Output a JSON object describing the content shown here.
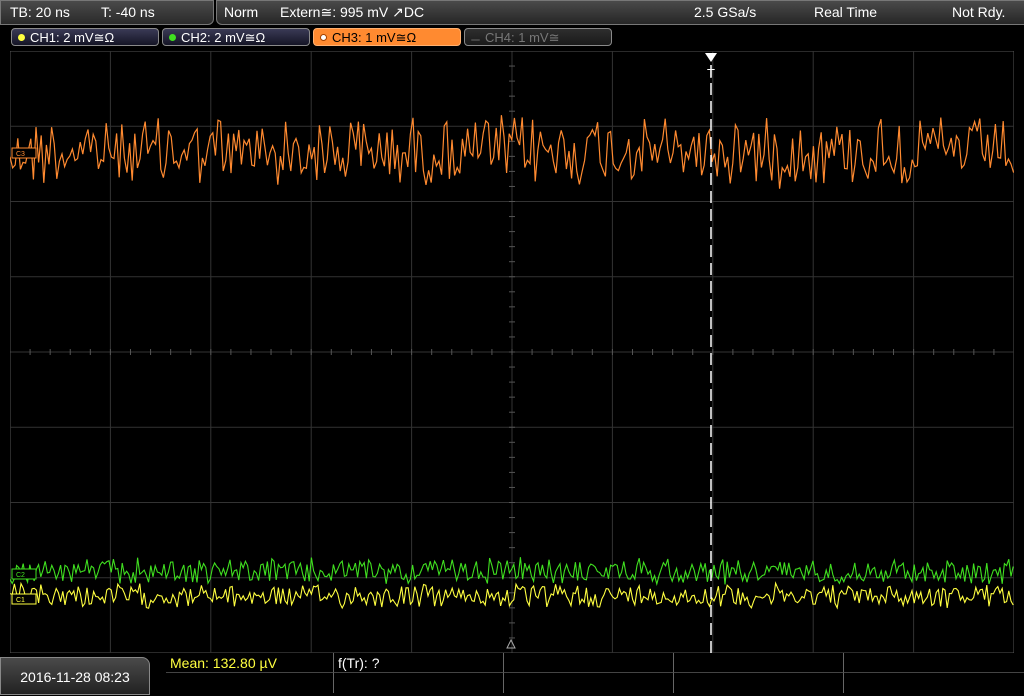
{
  "status": {
    "timebase": "TB: 20 ns",
    "trigger_time": "T: -40 ns",
    "mode": "Norm",
    "trigger_source": "Extern≅: 995 mV ↗DC",
    "sample_rate": "2.5 GSa/s",
    "acq_mode": "Real Time",
    "state": "Not Rdy."
  },
  "channels": [
    {
      "label": "CH1: 2 mV≅Ω",
      "color": "#ffff40",
      "state": "on"
    },
    {
      "label": "CH2: 2 mV≅Ω",
      "color": "#40e020",
      "state": "on"
    },
    {
      "label": "CH3: 1 mV≅Ω",
      "color": "#ff8a30",
      "state": "active"
    },
    {
      "label": "CH4: 1 mV≅",
      "color": "#777777",
      "state": "off"
    }
  ],
  "markers": {
    "ch3": "C3",
    "ch2": "C2",
    "ch1": "C1",
    "trigger": "T"
  },
  "footer": {
    "datetime": "2016-11-28 08:23",
    "mean_label": "Mean: 132.80 µV",
    "ftr_label": "f(Tr): ?"
  },
  "colors": {
    "ch1": "#ffff40",
    "ch2": "#40e020",
    "ch3": "#ff8a30",
    "grid": "#3a3a3a"
  }
}
